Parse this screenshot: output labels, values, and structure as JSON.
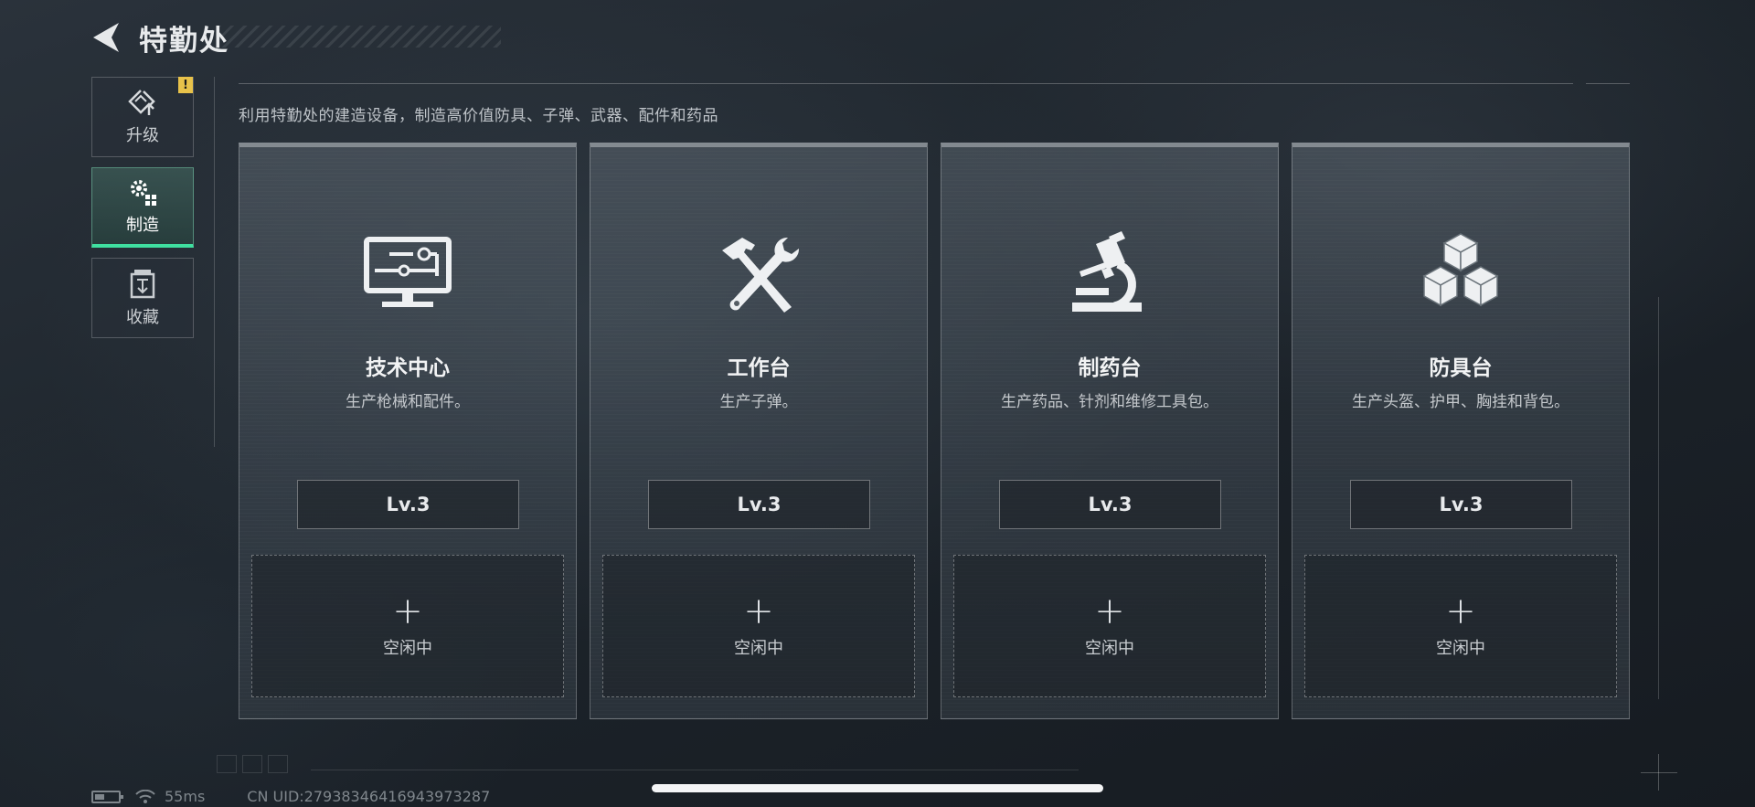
{
  "header": {
    "title": "特勤处",
    "back_icon": "back-arrow-icon"
  },
  "sidebar": {
    "items": [
      {
        "label": "升级",
        "icon": "upgrade-icon",
        "active": false,
        "badge": "!"
      },
      {
        "label": "制造",
        "icon": "manufacture-gears-icon",
        "active": true
      },
      {
        "label": "收藏",
        "icon": "collection-icon",
        "active": false
      }
    ]
  },
  "description": "利用特勤处的建造设备，制造高价值防具、子弹、武器、配件和药品",
  "stations": [
    {
      "name": "技术中心",
      "desc": "生产枪械和配件。",
      "level": "Lv.3",
      "icon": "monitor-icon",
      "slot_icon": "plus-icon",
      "slot_status": "空闲中"
    },
    {
      "name": "工作台",
      "desc": "生产子弹。",
      "level": "Lv.3",
      "icon": "hammer-wrench-icon",
      "slot_icon": "plus-icon",
      "slot_status": "空闲中"
    },
    {
      "name": "制药台",
      "desc": "生产药品、针剂和维修工具包。",
      "level": "Lv.3",
      "icon": "microscope-icon",
      "slot_icon": "plus-icon",
      "slot_status": "空闲中"
    },
    {
      "name": "防具台",
      "desc": "生产头盔、护甲、胸挂和背包。",
      "level": "Lv.3",
      "icon": "cubes-icon",
      "slot_icon": "plus-icon",
      "slot_status": "空闲中"
    }
  ],
  "status_bar": {
    "ping": "55ms",
    "uid": "CN UID:27938346416943973287"
  },
  "colors": {
    "accent": "#3fe0a0",
    "warning": "#e8c24a",
    "text": "#e4e6e8"
  }
}
